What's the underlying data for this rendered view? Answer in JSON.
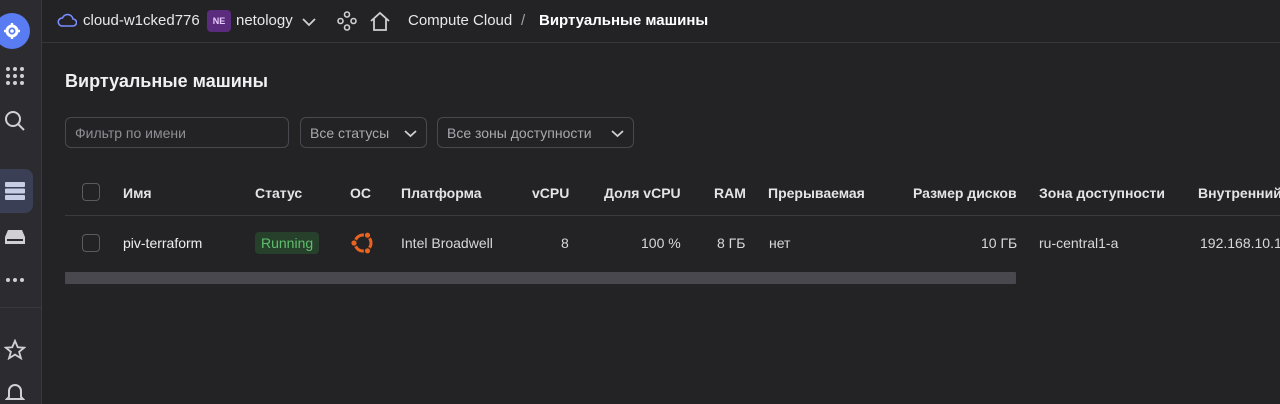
{
  "header": {
    "cloud_name": "cloud-w1cked776",
    "org_badge": "NE",
    "org_name": "netology",
    "breadcrumb_service": "Compute Cloud",
    "breadcrumb_separator": "/",
    "breadcrumb_current": "Виртуальные машины"
  },
  "page": {
    "title": "Виртуальные машины"
  },
  "filters": {
    "name_placeholder": "Фильтр по имени",
    "status_select": "Все статусы",
    "zone_select": "Все зоны доступности"
  },
  "table": {
    "columns": [
      "Имя",
      "Статус",
      "ОС",
      "Платформа",
      "vCPU",
      "Доля vCPU",
      "RAM",
      "Прерываемая",
      "Размер дисков",
      "Зона доступности",
      "Внутренний"
    ],
    "rows": [
      {
        "name": "piv-terraform",
        "status": "Running",
        "os_icon": "ubuntu-icon",
        "platform": "Intel Broadwell",
        "vcpu": "8",
        "vcpu_share": "100 %",
        "ram": "8 ГБ",
        "preemptible": "нет",
        "disk_size": "10 ГБ",
        "zone": "ru-central1-a",
        "internal_ip": "192.168.10.1"
      }
    ]
  },
  "colors": {
    "background": "#232326",
    "status_running": "#5fbf6a",
    "ubuntu_orange": "#e9631f",
    "accent": "#5a7cf3"
  }
}
